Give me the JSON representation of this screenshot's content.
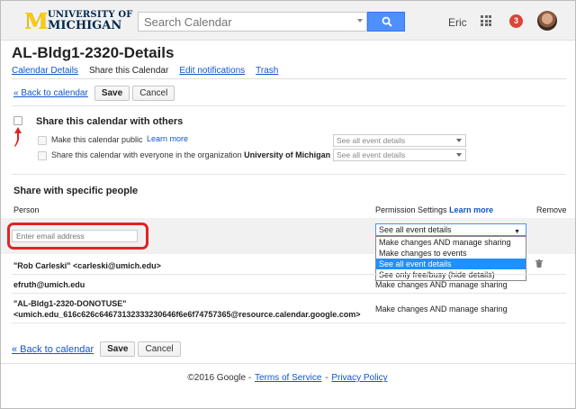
{
  "header": {
    "logo_line1": "UNIVERSITY OF",
    "logo_line2": "MICHIGAN",
    "search_placeholder": "Search Calendar",
    "user_name": "Eric",
    "notification_count": "3"
  },
  "page": {
    "title": "AL-Bldg1-2320-Details",
    "tabs": [
      {
        "label": "Calendar Details",
        "active": false
      },
      {
        "label": "Share this Calendar",
        "active": true
      },
      {
        "label": "Edit notifications",
        "active": false
      },
      {
        "label": "Trash",
        "active": false
      }
    ]
  },
  "actions": {
    "back_label": "« Back to calendar",
    "save_label": "Save",
    "cancel_label": "Cancel"
  },
  "share": {
    "main_label": "Share this calendar with others",
    "public_label": "Make this calendar public",
    "learn_more": "Learn more",
    "org_label": "Share this calendar with everyone in the organization",
    "org_name": "University of Michigan",
    "public_select": "See all event details",
    "org_select": "See all event details"
  },
  "people": {
    "section_title": "Share with specific people",
    "col_person": "Person",
    "col_permission": "Permission Settings",
    "col_learn_more": "Learn more",
    "col_remove": "Remove",
    "email_placeholder": "Enter email address",
    "permission_selected": "See all event details",
    "permission_options": [
      "Make changes AND manage sharing",
      "Make changes to events",
      "See all event details",
      "See only free/busy (hide details)"
    ],
    "rows": [
      {
        "person": "\"Rob Carleski\" <carleski@umich.edu>",
        "permission": ""
      },
      {
        "person": "efruth@umich.edu",
        "permission": "Make changes AND manage sharing"
      },
      {
        "person_line1": "\"AL-Bldg1-2320-DONOTUSE\"",
        "person_line2": "<umich.edu_616c626c64673132333230646f6e6f74757365@resource.calendar.google.com>",
        "permission": "Make changes AND manage sharing"
      }
    ]
  },
  "footer": {
    "copyright": "©2016 Google",
    "sep": "-",
    "terms": "Terms of Service",
    "privacy": "Privacy Policy"
  },
  "colors": {
    "accent_blue": "#4d90fe",
    "link": "#1155cc",
    "highlight_red": "#e02424",
    "selected_option": "#1e90ff",
    "notification": "#db4437"
  }
}
